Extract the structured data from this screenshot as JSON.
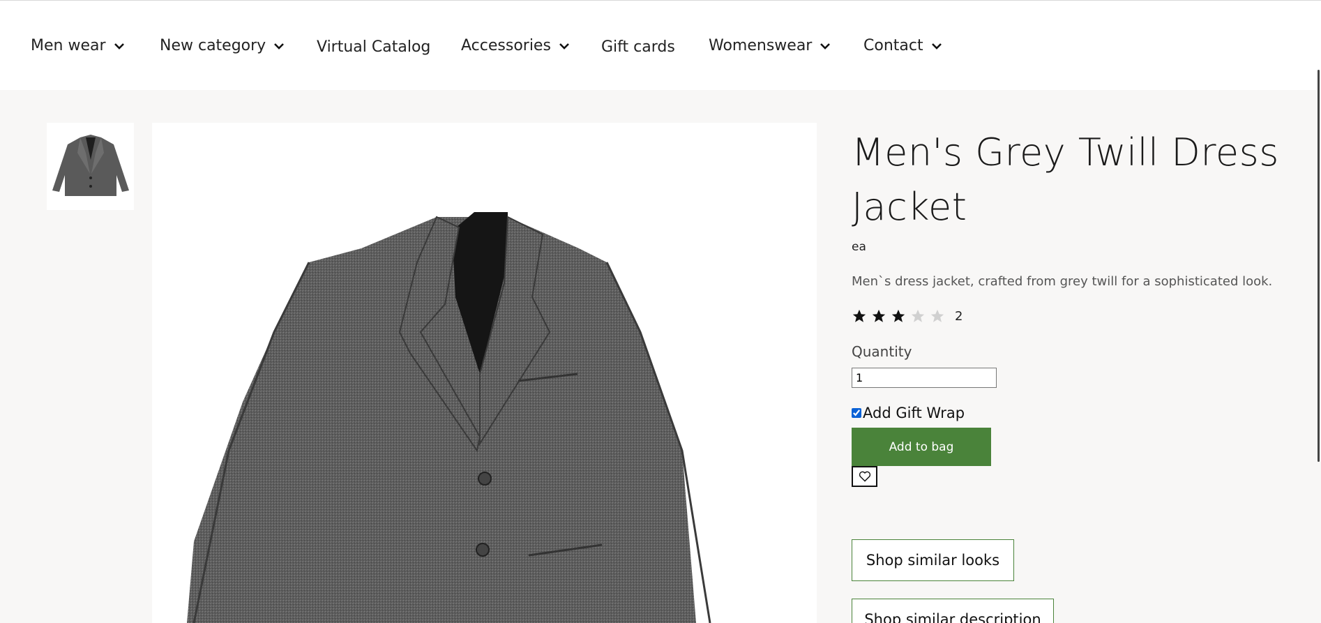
{
  "nav": {
    "items": [
      {
        "label": "Men wear",
        "has_dropdown": true
      },
      {
        "label": "New category",
        "has_dropdown": true
      },
      {
        "label": "Virtual Catalog",
        "has_dropdown": false
      },
      {
        "label": "Accessories",
        "has_dropdown": true
      },
      {
        "label": "Gift cards",
        "has_dropdown": false
      },
      {
        "label": "Womenswear",
        "has_dropdown": true
      },
      {
        "label": "Contact",
        "has_dropdown": true
      }
    ]
  },
  "product": {
    "title": "Men's Grey Twill Dress Jacket",
    "unit": "ea",
    "description": "Men`s dress jacket, crafted from grey twill for a sophisticated look.",
    "rating": {
      "value": 3,
      "max": 5,
      "count": "2"
    },
    "quantity_label": "Quantity",
    "quantity_value": "1",
    "gift_wrap_label": "Add Gift Wrap",
    "gift_wrap_checked": true,
    "add_to_bag_label": "Add to bag",
    "shop_similar_looks_label": "Shop similar looks",
    "shop_similar_description_label": "Shop similar description"
  },
  "icons": {
    "dropdown": "chevron-down-icon",
    "wishlist": "heart-icon",
    "star": "star-icon"
  },
  "colors": {
    "accent": "#4a833a",
    "star_filled": "#111111",
    "star_empty": "#d0d0d0",
    "page_bg": "#f8f7f6"
  }
}
